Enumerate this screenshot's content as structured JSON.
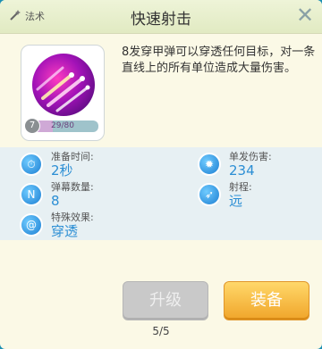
{
  "header": {
    "tag_label": "法术",
    "title": "快速射击",
    "close_icon": "close-icon"
  },
  "skill": {
    "level_badge": "7",
    "progress_text": "29/80",
    "progress_fraction": 0.3625,
    "description": "8发穿甲弹可以穿透任何目标，对一条直线上的所有单位造成大量伤害。"
  },
  "stats": [
    {
      "label": "准备时间:",
      "value": "2秒",
      "icon": "stopwatch-icon"
    },
    {
      "label": "单发伤害:",
      "value": "234",
      "icon": "explosion-icon"
    },
    {
      "label": "弹幕数量:",
      "value": "8",
      "icon": "barrage-count-icon"
    },
    {
      "label": "射程:",
      "value": "远",
      "icon": "range-icon"
    },
    {
      "label": "特殊效果:",
      "value": "穿透",
      "icon": "swirl-icon"
    }
  ],
  "actions": {
    "upgrade_label": "升级",
    "equip_label": "装备"
  },
  "pagination": {
    "text": "5/5"
  },
  "colors": {
    "panel_bg": "#fbf9e6",
    "value_blue": "#2b8ed4",
    "equip_orange": "#f0a52a",
    "upgrade_gray": "#c9c9c9"
  }
}
